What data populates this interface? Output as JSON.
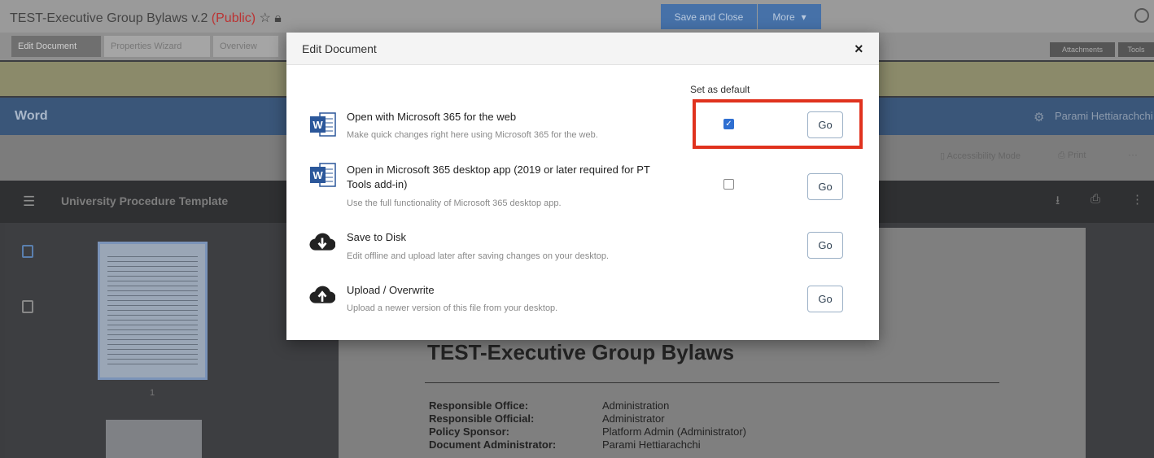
{
  "topbar": {
    "title": "TEST-Executive Group Bylaws v.2",
    "visibility": "(Public)",
    "save_close": "Save and Close",
    "more": "More"
  },
  "tabs": [
    "Edit Document",
    "Properties Wizard",
    "Overview"
  ],
  "right_tabs": [
    "Attachments",
    "Tools"
  ],
  "word_bar": {
    "label": "Word",
    "user": "Parami Hettiarachchi"
  },
  "toolbar": {
    "accessibility": "Accessibility Mode",
    "print": "Print",
    "more": "···"
  },
  "viewer": {
    "title": "University Procedure Template",
    "page_number": "1"
  },
  "document": {
    "heading": "TEST-Executive Group Bylaws",
    "meta": [
      {
        "label": "Responsible Office:",
        "value": "Administration"
      },
      {
        "label": "Responsible Official:",
        "value": "Administrator"
      },
      {
        "label": "Policy Sponsor:",
        "value": "Platform Admin (Administrator)"
      },
      {
        "label": "Document Administrator:",
        "value": "Parami Hettiarachchi"
      }
    ]
  },
  "modal": {
    "title": "Edit Document",
    "close": "×",
    "set_default_label": "Set as default",
    "options": [
      {
        "title": "Open with Microsoft 365 for the web",
        "desc": "Make quick changes right here using Microsoft 365 for the web.",
        "icon": "word-icon",
        "default": true,
        "go": "Go"
      },
      {
        "title": "Open in Microsoft 365 desktop app (2019 or later required for PT Tools add-in)",
        "desc": "Use the full functionality of Microsoft 365 desktop app.",
        "icon": "word-icon",
        "default": false,
        "go": "Go"
      },
      {
        "title": "Save to Disk",
        "desc": "Edit offline and upload later after saving changes on your desktop.",
        "icon": "cloud-download-icon",
        "go": "Go"
      },
      {
        "title": "Upload / Overwrite",
        "desc": "Upload a newer version of this file from your desktop.",
        "icon": "cloud-upload-icon",
        "go": "Go"
      }
    ]
  },
  "colors": {
    "highlight": "#e0321e",
    "checkbox": "#2f6fd1",
    "word_blue": "#2b579a"
  }
}
